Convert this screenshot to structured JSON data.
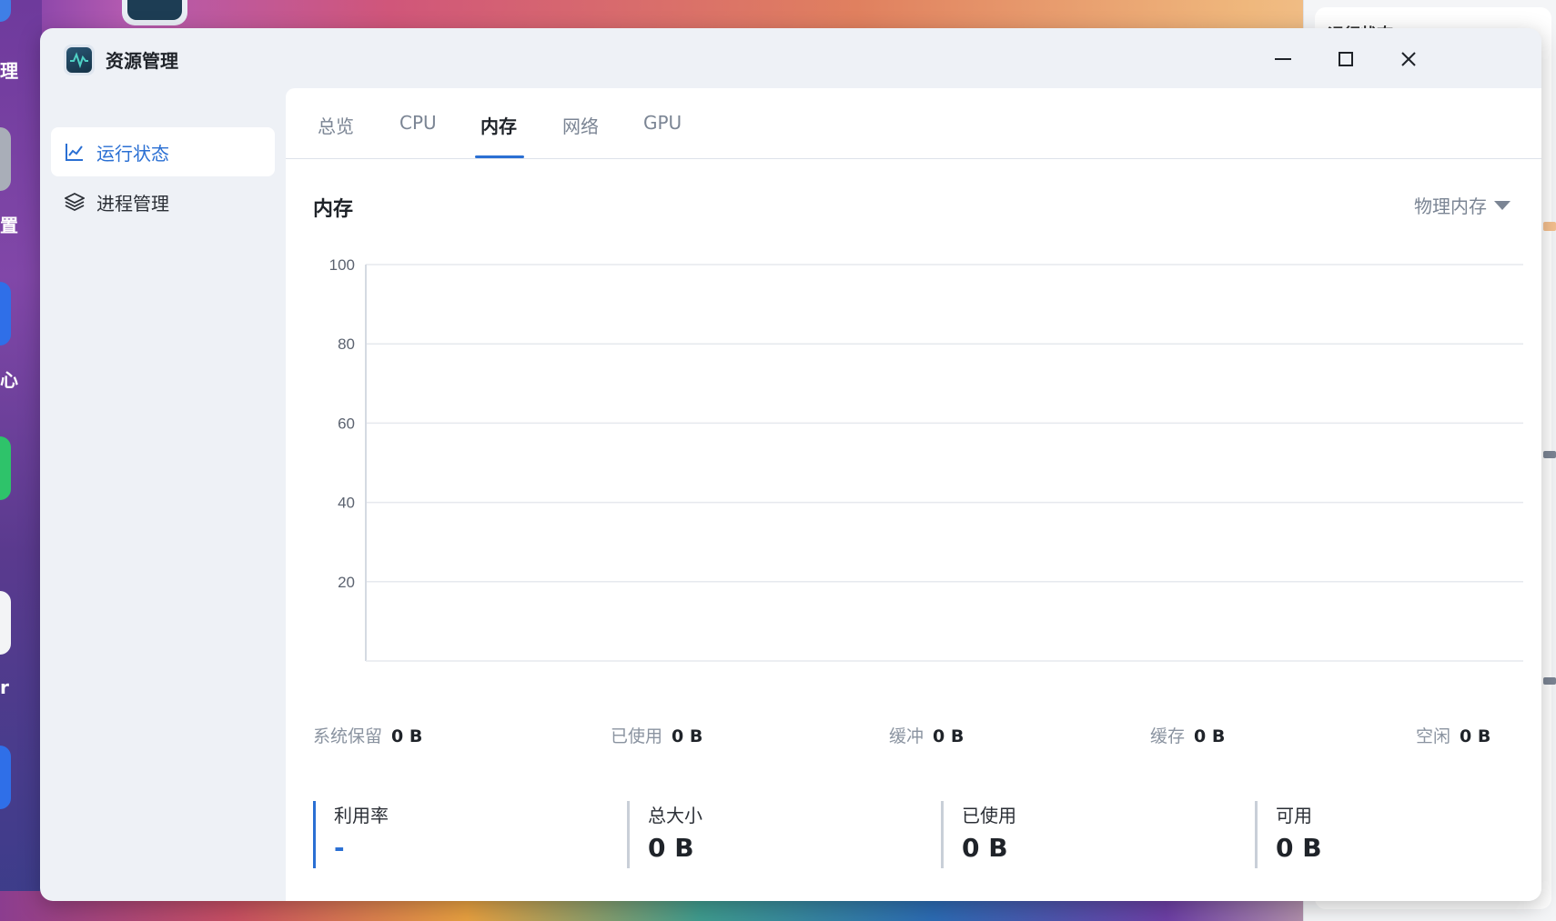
{
  "desktop": {
    "left_labels": [
      "理",
      "置",
      "心",
      "r"
    ]
  },
  "right_panel": {
    "title": "运行状态"
  },
  "window": {
    "title": "资源管理",
    "controls": [
      "minimize",
      "maximize",
      "close"
    ]
  },
  "sidebar": {
    "items": [
      {
        "label": "运行状态",
        "icon": "line-chart-icon",
        "active": true
      },
      {
        "label": "进程管理",
        "icon": "layers-icon",
        "active": false
      }
    ]
  },
  "tabs": [
    {
      "label": "总览",
      "active": false
    },
    {
      "label": "CPU",
      "active": false
    },
    {
      "label": "内存",
      "active": true
    },
    {
      "label": "网络",
      "active": false
    },
    {
      "label": "GPU",
      "active": false
    }
  ],
  "section": {
    "title": "内存",
    "select_value": "物理内存"
  },
  "chart_data": {
    "type": "line",
    "title": "",
    "xlabel": "",
    "ylabel": "",
    "ylim": [
      0,
      100
    ],
    "yticks": [
      20,
      40,
      60,
      80,
      100
    ],
    "grid": true,
    "series": [],
    "colors": {
      "grid": "#e6e9ee",
      "axis": "#d5dae2",
      "tick_text": "#5c6370"
    }
  },
  "stats": [
    {
      "label": "系统保留",
      "value": "0 B"
    },
    {
      "label": "已使用",
      "value": "0 B"
    },
    {
      "label": "缓冲",
      "value": "0 B"
    },
    {
      "label": "缓存",
      "value": "0 B"
    },
    {
      "label": "空闲",
      "value": "0 B"
    }
  ],
  "cards": [
    {
      "label": "利用率",
      "value": "-"
    },
    {
      "label": "总大小",
      "value": "0 B"
    },
    {
      "label": "已使用",
      "value": "0 B"
    },
    {
      "label": "可用",
      "value": "0 B"
    }
  ],
  "colors": {
    "accent": "#2a6fd3",
    "window_bg": "#eef1f6",
    "main_bg": "#ffffff"
  }
}
